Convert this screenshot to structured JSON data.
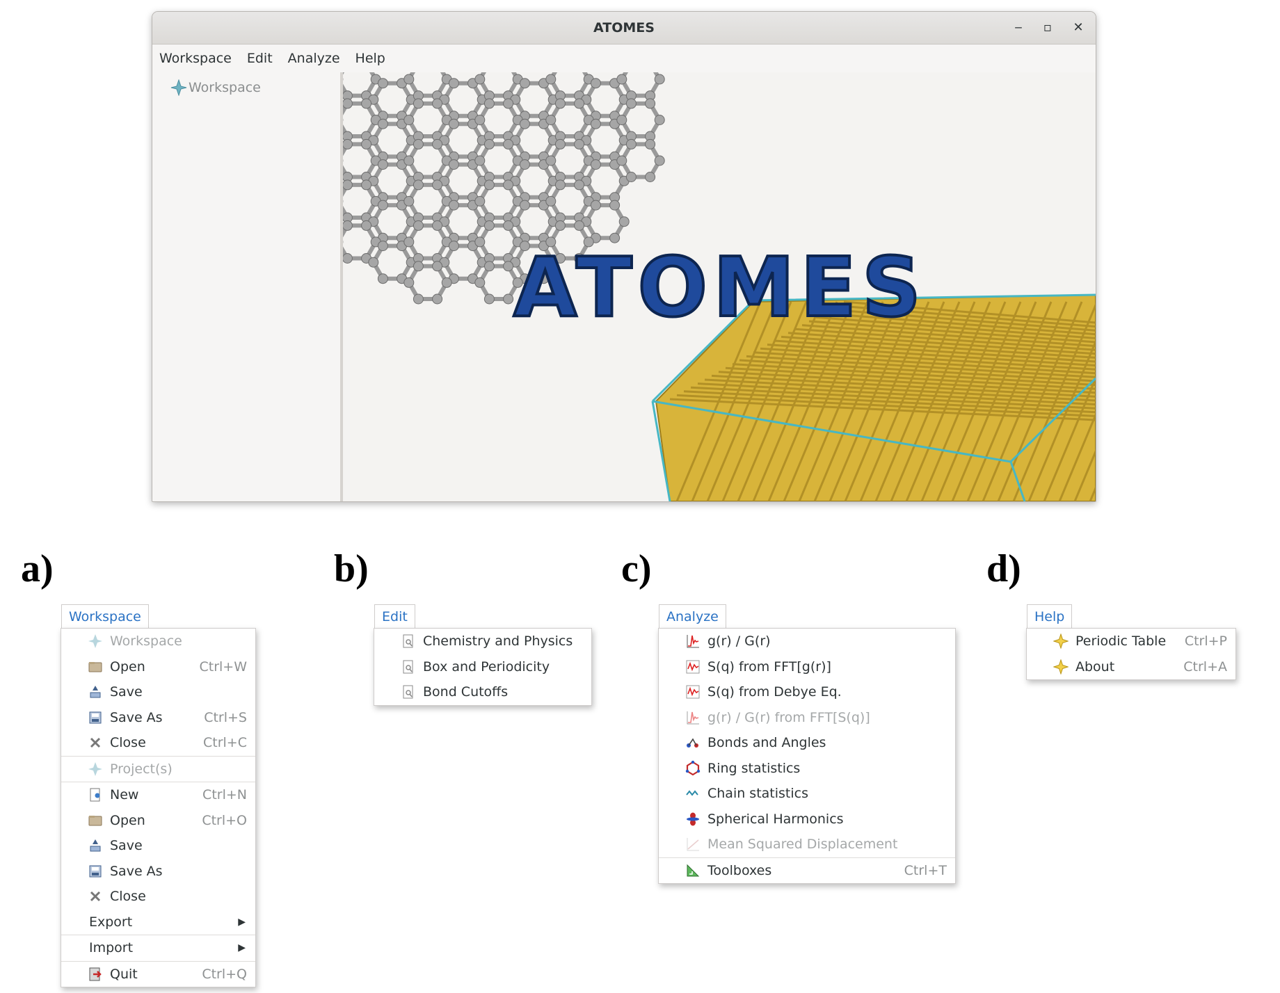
{
  "window": {
    "title": "ATOMES",
    "controls": {
      "minimize": "‒",
      "maximize": "▫",
      "close": "✕"
    },
    "menubar": [
      "Workspace",
      "Edit",
      "Analyze",
      "Help"
    ],
    "tree_root": "Workspace"
  },
  "panel_labels": [
    "a)",
    "b)",
    "c)",
    "d)"
  ],
  "workspace_menu": {
    "tab": "Workspace",
    "items": [
      {
        "label": "Workspace",
        "shortcut": "",
        "icon": "workspace-icon",
        "disabled": true
      },
      {
        "label": "Open",
        "shortcut": "Ctrl+W",
        "icon": "folder-icon"
      },
      {
        "label": "Save",
        "shortcut": "",
        "icon": "save-icon"
      },
      {
        "label": "Save As",
        "shortcut": "Ctrl+S",
        "icon": "save-as-icon"
      },
      {
        "label": "Close",
        "shortcut": "Ctrl+C",
        "icon": "close-icon"
      },
      {
        "label": "Project(s)",
        "shortcut": "",
        "icon": "workspace-icon",
        "disabled": true
      },
      {
        "label": "New",
        "shortcut": "Ctrl+N",
        "icon": "new-icon"
      },
      {
        "label": "Open",
        "shortcut": "Ctrl+O",
        "icon": "folder-icon"
      },
      {
        "label": "Save",
        "shortcut": "",
        "icon": "save-icon"
      },
      {
        "label": "Save As",
        "shortcut": "",
        "icon": "save-as-icon"
      },
      {
        "label": "Close",
        "shortcut": "",
        "icon": "close-icon"
      },
      {
        "label": "Export",
        "shortcut": "",
        "submenu": true
      },
      {
        "label": "Import",
        "shortcut": "",
        "submenu": true
      },
      {
        "label": "Quit",
        "shortcut": "Ctrl+Q",
        "icon": "quit-icon"
      }
    ]
  },
  "edit_menu": {
    "tab": "Edit",
    "items": [
      {
        "label": "Chemistry and Physics",
        "icon": "edit-icon"
      },
      {
        "label": "Box and Periodicity",
        "icon": "edit-icon"
      },
      {
        "label": "Bond Cutoffs",
        "icon": "edit-icon"
      }
    ]
  },
  "analyze_menu": {
    "tab": "Analyze",
    "items": [
      {
        "label": "g(r) / G(r)",
        "shortcut": "",
        "icon": "gr-icon"
      },
      {
        "label": "S(q) from FFT[g(r)]",
        "shortcut": "",
        "icon": "sq-icon"
      },
      {
        "label": "S(q) from Debye Eq.",
        "shortcut": "",
        "icon": "sq-icon"
      },
      {
        "label": "g(r) / G(r) from FFT[S(q)]",
        "shortcut": "",
        "icon": "gr-icon",
        "disabled": true
      },
      {
        "label": "Bonds and Angles",
        "shortcut": "",
        "icon": "bonds-icon"
      },
      {
        "label": "Ring statistics",
        "shortcut": "",
        "icon": "ring-icon"
      },
      {
        "label": "Chain statistics",
        "shortcut": "",
        "icon": "chain-icon"
      },
      {
        "label": "Spherical Harmonics",
        "shortcut": "",
        "icon": "harmonics-icon"
      },
      {
        "label": "Mean Squared Displacement",
        "shortcut": "",
        "icon": "msd-icon",
        "disabled": true
      },
      {
        "label": "Toolboxes",
        "shortcut": "Ctrl+T",
        "icon": "toolbox-icon"
      }
    ]
  },
  "help_menu": {
    "tab": "Help",
    "items": [
      {
        "label": "Periodic Table",
        "shortcut": "Ctrl+P",
        "icon": "star-icon"
      },
      {
        "label": "About",
        "shortcut": "Ctrl+A",
        "icon": "star-icon"
      }
    ]
  },
  "splash": {
    "logo_text": "ATOMES",
    "colors": {
      "logo": "#1f4a9c",
      "gold": "#d8b43a",
      "cell": "#47b7c4",
      "carbon": "#a6a6a6"
    }
  }
}
